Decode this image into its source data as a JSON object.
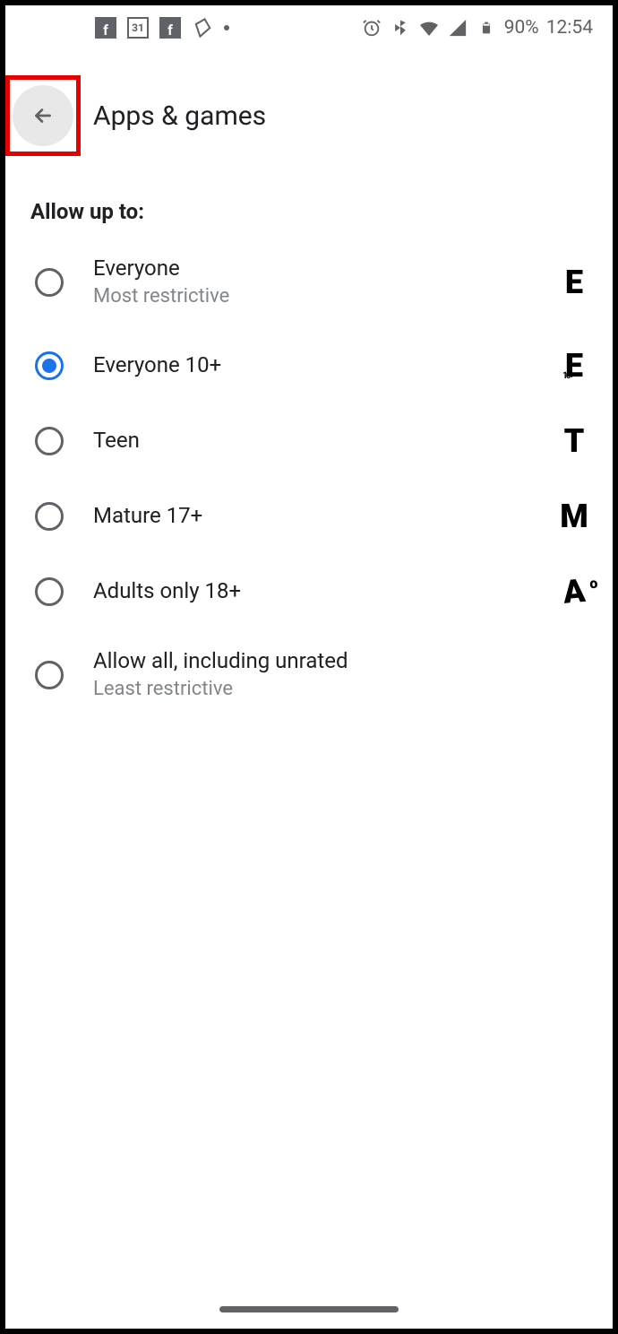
{
  "status_bar": {
    "calendar_day": "31",
    "battery_percent": "90%",
    "time": "12:54"
  },
  "header": {
    "title": "Apps & games"
  },
  "section": {
    "heading": "Allow up to:"
  },
  "options": [
    {
      "label": "Everyone",
      "sublabel": "Most restrictive",
      "rating": "E",
      "selected": false
    },
    {
      "label": "Everyone 10+",
      "sublabel": "",
      "rating": "E",
      "selected": true
    },
    {
      "label": "Teen",
      "sublabel": "",
      "rating": "T",
      "selected": false
    },
    {
      "label": "Mature 17+",
      "sublabel": "",
      "rating": "M",
      "selected": false
    },
    {
      "label": "Adults only 18+",
      "sublabel": "",
      "rating": "A",
      "selected": false
    },
    {
      "label": "Allow all, including unrated",
      "sublabel": "Least restrictive",
      "rating": "",
      "selected": false
    }
  ]
}
